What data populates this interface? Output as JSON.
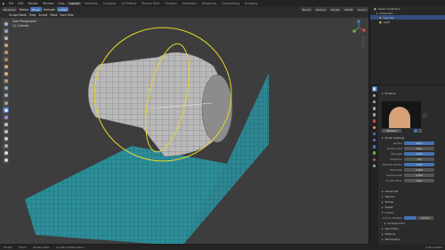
{
  "topbar": {
    "menus": [
      "File",
      "Edit",
      "Render",
      "Window",
      "Help"
    ],
    "workspace_tabs": [
      "Layout",
      "Modeling",
      "Sculpting",
      "UV Editing",
      "Texture Paint",
      "Shading",
      "Animation",
      "Rendering",
      "Compositing",
      "Scripting"
    ],
    "active_tab": "Layout"
  },
  "header": {
    "brush_name": "Blob/Add",
    "radius_label": "Radius",
    "radius_value": "50 px",
    "strength_label": "Strength",
    "strength_value": "0.500",
    "menus": [
      "Sculpt Mode",
      "View",
      "Sculpt",
      "Mask",
      "Face Sets"
    ],
    "right_items": [
      "Brush",
      "Texture",
      "Stroke",
      "Falloff",
      "Cursor"
    ]
  },
  "viewport": {
    "view_name": "User Perspective",
    "collection_label": "(1) Cylinder"
  },
  "outliner": {
    "title": "Scene Collection",
    "rows": [
      {
        "label": "Scene Collection",
        "selected": false
      },
      {
        "label": "Collection",
        "selected": false
      },
      {
        "label": "Cylinder",
        "selected": true
      },
      {
        "label": "Light",
        "selected": false
      }
    ]
  },
  "properties": {
    "brush_section": "Brushes",
    "brush_preview_name": "BlobAdd",
    "settings_title": "Brush Settings",
    "fields": [
      {
        "label": "Radius",
        "value": "50 px",
        "highlight": true
      },
      {
        "label": "Radius Unit",
        "value": "View",
        "highlight": false
      },
      {
        "label": "Strength",
        "value": "0.500",
        "highlight": true
      },
      {
        "label": "Direction",
        "value": "Add",
        "highlight": false
      },
      {
        "label": "Normal Radius",
        "value": "0.500",
        "highlight": true
      },
      {
        "label": "Hardness",
        "value": "0.000",
        "highlight": false
      },
      {
        "label": "Autosmooth",
        "value": "0.000",
        "highlight": false
      },
      {
        "label": "Sculpt Plane",
        "value": "Area",
        "highlight": false
      }
    ],
    "collapsed_sections": [
      "Advanced",
      "Texture",
      "Stroke",
      "Falloff"
    ],
    "cursor_title": "Cursor",
    "cursor_fields": [
      {
        "label": "Cursor Display",
        "value": "Cursor"
      }
    ],
    "more_sections": [
      "Inverse Color",
      "Symmetry",
      "Options",
      "Workspace"
    ]
  },
  "status": {
    "left_items": [
      "Sculpt",
      "Move",
      "Rotate View",
      "Sculpt Context Menu"
    ],
    "right_text": "2.90.0 Alpha"
  }
}
